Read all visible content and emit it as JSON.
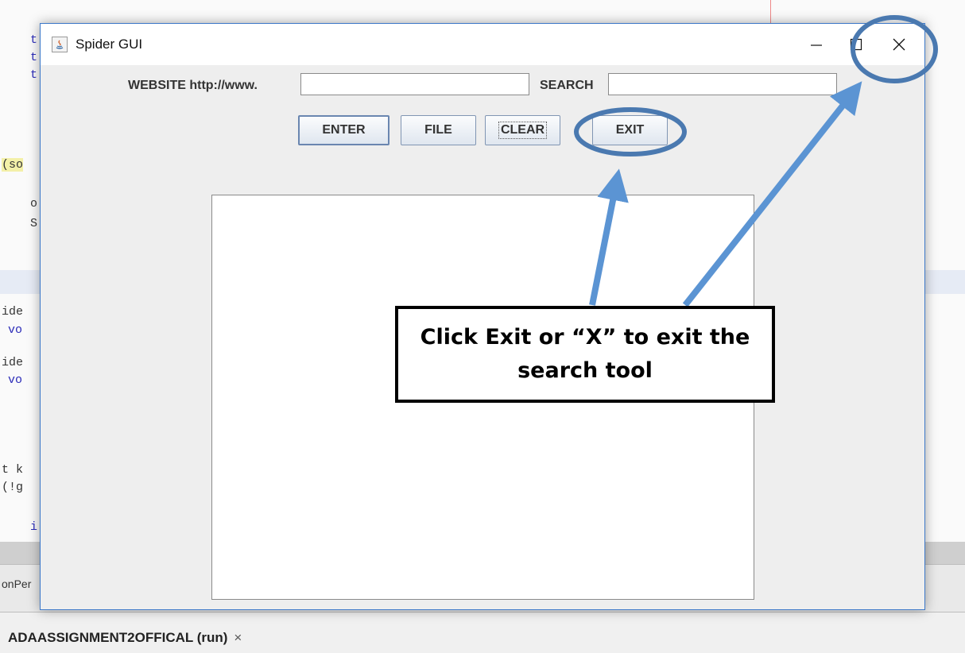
{
  "ide": {
    "code_fragments": [
      "t",
      "t",
      "t",
      "(so",
      "o",
      "S",
      "ide",
      "vo",
      "ide",
      "vo",
      "t k",
      "(!g",
      "i",
      "onPer"
    ],
    "run_tab": {
      "label": "ADAASSIGNMENT2OFFICAL (run)",
      "close_glyph": "×"
    }
  },
  "window": {
    "title": "Spider GUI",
    "controls": {
      "minimize": "—",
      "maximize": "☐",
      "close": "✕"
    }
  },
  "form": {
    "website_label": "WEBSITE http://www.",
    "website_value": "",
    "search_label": "SEARCH",
    "search_value": ""
  },
  "buttons": {
    "enter": "ENTER",
    "file": "FILE",
    "clear": "CLEAR",
    "exit": "EXIT"
  },
  "annotation": {
    "callout_text": "Click Exit or “X” to exit the search tool",
    "color": "#4a79b0",
    "arrow_color": "#5b94d3"
  }
}
